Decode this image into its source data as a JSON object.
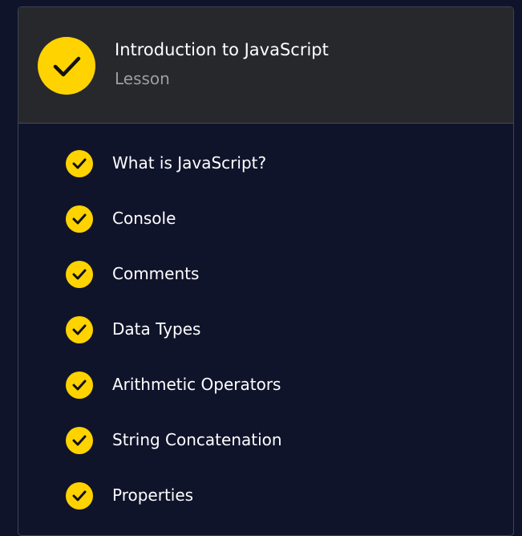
{
  "lesson": {
    "title": "Introduction to JavaScript",
    "subtitle": "Lesson",
    "status_icon": "check-circle-icon",
    "accent_color": "#ffd300"
  },
  "items": [
    {
      "label": "What is JavaScript?",
      "completed": true,
      "icon": "check-circle-icon"
    },
    {
      "label": "Console",
      "completed": true,
      "icon": "check-circle-icon"
    },
    {
      "label": "Comments",
      "completed": true,
      "icon": "check-circle-icon"
    },
    {
      "label": "Data Types",
      "completed": true,
      "icon": "check-circle-icon"
    },
    {
      "label": "Arithmetic Operators",
      "completed": true,
      "icon": "check-circle-icon"
    },
    {
      "label": "String Concatenation",
      "completed": true,
      "icon": "check-circle-icon"
    },
    {
      "label": "Properties",
      "completed": true,
      "icon": "check-circle-icon"
    }
  ]
}
